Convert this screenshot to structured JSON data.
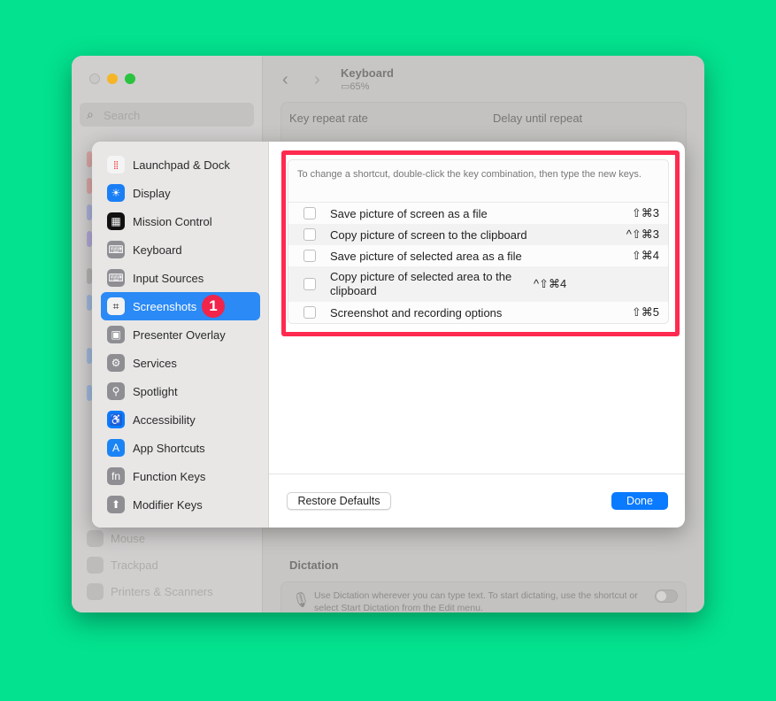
{
  "window": {
    "title": "Keyboard",
    "battery": "65%",
    "search_placeholder": "Search",
    "background_labels": {
      "key_repeat": "Key repeat rate",
      "delay": "Delay until repeat",
      "dictation": "Dictation",
      "dictation_text": "Use Dictation wherever you can type text. To start dictating, use the shortcut or select Start Dictation from the Edit menu."
    },
    "sidebar_ghost": [
      "Mouse",
      "Trackpad",
      "Printers & Scanners"
    ]
  },
  "sheet": {
    "sidebar": [
      {
        "label": "Launchpad & Dock",
        "icon": "launchpad-icon"
      },
      {
        "label": "Display",
        "icon": "display-icon"
      },
      {
        "label": "Mission Control",
        "icon": "mission-control-icon"
      },
      {
        "label": "Keyboard",
        "icon": "keyboard-icon"
      },
      {
        "label": "Input Sources",
        "icon": "input-sources-icon"
      },
      {
        "label": "Screenshots",
        "icon": "screenshots-icon",
        "selected": true,
        "badge": "1"
      },
      {
        "label": "Presenter Overlay",
        "icon": "presenter-overlay-icon"
      },
      {
        "label": "Services",
        "icon": "services-icon"
      },
      {
        "label": "Spotlight",
        "icon": "spotlight-icon"
      },
      {
        "label": "Accessibility",
        "icon": "accessibility-icon"
      },
      {
        "label": "App Shortcuts",
        "icon": "app-shortcuts-icon"
      },
      {
        "label": "Function Keys",
        "icon": "function-keys-icon",
        "glyph": "fn"
      },
      {
        "label": "Modifier Keys",
        "icon": "modifier-keys-icon"
      }
    ],
    "hint": "To change a shortcut, double-click the key combination, then type the new keys.",
    "shortcuts": [
      {
        "label": "Save picture of screen as a file",
        "keys": "⇧⌘3",
        "checked": false
      },
      {
        "label": "Copy picture of screen to the clipboard",
        "keys": "^⇧⌘3",
        "checked": false
      },
      {
        "label": "Save picture of selected area as a file",
        "keys": "⇧⌘4",
        "checked": false
      },
      {
        "label": "Copy picture of selected area to the clipboard",
        "keys": "^⇧⌘4",
        "checked": false
      },
      {
        "label": "Screenshot and recording options",
        "keys": "⇧⌘5",
        "checked": false
      }
    ],
    "restore_label": "Restore Defaults",
    "done_label": "Done"
  },
  "colors": {
    "background": "#03e28e",
    "accent": "#0a7aff",
    "highlight": "#ff2a4f",
    "selected": "#2b8af5"
  }
}
